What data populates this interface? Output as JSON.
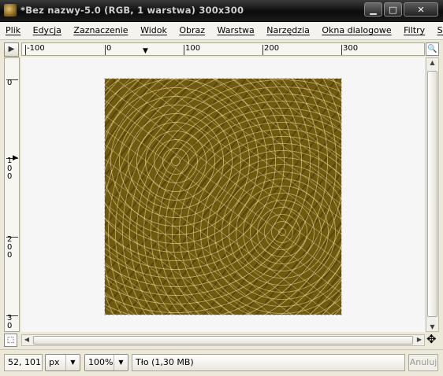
{
  "window": {
    "title": "*Bez nazwy-5.0 (RGB, 1 warstwa) 300x300",
    "min_label": "▁",
    "max_label": "□",
    "close_label": "✕"
  },
  "menu": {
    "items": [
      {
        "label": "Plik"
      },
      {
        "label": "Edycja"
      },
      {
        "label": "Zaznaczenie"
      },
      {
        "label": "Widok"
      },
      {
        "label": "Obraz"
      },
      {
        "label": "Warstwa"
      },
      {
        "label": "Narzędzia"
      },
      {
        "label": "Okna dialogowe"
      },
      {
        "label": "Filtry"
      },
      {
        "label": "Script-Fu"
      }
    ]
  },
  "rulers": {
    "horizontal": [
      "-100",
      "0",
      "100",
      "200",
      "300"
    ],
    "vertical": [
      "0",
      "100",
      "200",
      "300"
    ]
  },
  "icons": {
    "nav_toggle": "play-triangle-icon",
    "zoom_toggle": "magnifier-icon",
    "quick_mask": "quick-mask-icon",
    "navigate": "move-cross-icon"
  },
  "status": {
    "coords": "52, 101",
    "unit": "px",
    "zoom": "100%",
    "message": "Tło (1,30 MB)",
    "cancel_label": "Anuluj"
  },
  "colors": {
    "image_base": "#6f5a0f",
    "image_lines": "#f0e1a0",
    "canvas_bg": "#f6f6f6"
  }
}
